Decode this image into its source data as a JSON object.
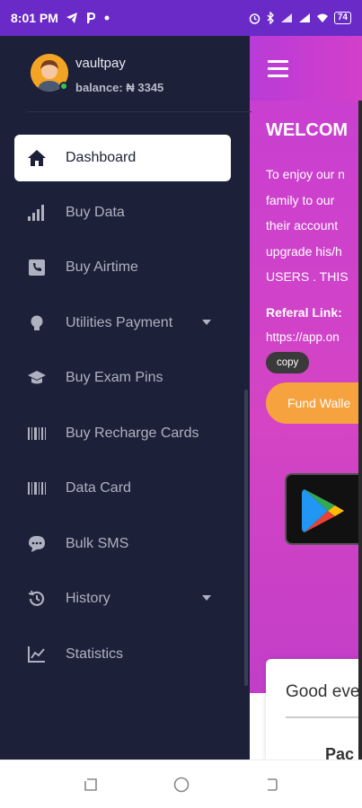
{
  "status_bar": {
    "time": "8:01 PM",
    "left_icons": [
      "telegram-icon",
      "paypal-icon",
      "dot-icon"
    ],
    "right_icons": [
      "alarm-icon",
      "bluetooth-icon",
      "signal-icon",
      "signal-4g-icon",
      "wifi-icon"
    ],
    "battery": "74"
  },
  "drawer": {
    "profile": {
      "name": "vaultpay",
      "balance": "balance: ₦ 3345"
    },
    "items": [
      {
        "label": "Dashboard",
        "icon": "home-icon",
        "active": true
      },
      {
        "label": "Buy Data",
        "icon": "signal-bars-icon"
      },
      {
        "label": "Buy Airtime",
        "icon": "phone-icon"
      },
      {
        "label": "Utilities Payment",
        "icon": "bulb-icon",
        "dropdown": true
      },
      {
        "label": "Buy Exam Pins",
        "icon": "graduation-cap-icon"
      },
      {
        "label": "Buy Recharge Cards",
        "icon": "barcode-icon"
      },
      {
        "label": "Data Card",
        "icon": "barcode-icon"
      },
      {
        "label": "Bulk SMS",
        "icon": "chat-icon"
      },
      {
        "label": "History",
        "icon": "history-icon",
        "dropdown": true
      },
      {
        "label": "Statistics",
        "icon": "chart-icon"
      }
    ]
  },
  "main": {
    "welcome": "WELCOM",
    "intro_lines": [
      "To enjoy our n",
      "family to our",
      "their account",
      "upgrade his/h",
      "USERS . THIS"
    ],
    "referral_label": "Referal Link:",
    "referral_link": "https://app.on",
    "copy_label": "copy",
    "fund_wallet_label": "Fund Walle",
    "greeting": "Good eve",
    "greeting_sub": "Pac"
  },
  "colors": {
    "status_bar": "#6a2ac7",
    "drawer_bg": "#1c2139",
    "accent_pink": "#c93fd0",
    "fund_button": "#f6a23f",
    "online": "#33c35a"
  }
}
